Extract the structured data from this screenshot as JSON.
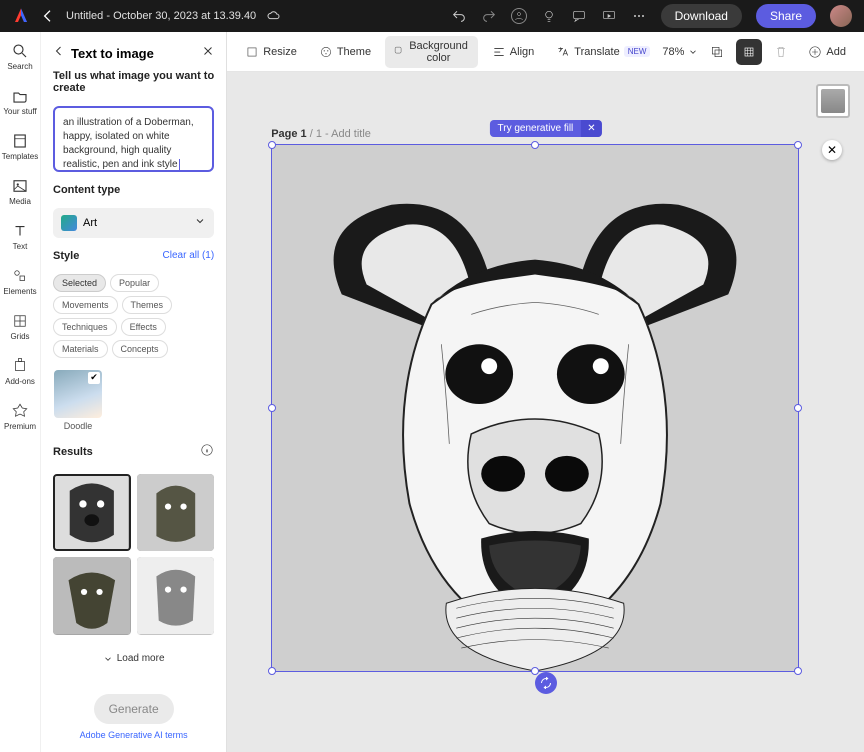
{
  "topbar": {
    "title": "Untitled - October 30, 2023 at 13.39.40",
    "download": "Download",
    "share": "Share"
  },
  "leftbar": {
    "items": [
      {
        "label": "Search"
      },
      {
        "label": "Your stuff"
      },
      {
        "label": "Templates"
      },
      {
        "label": "Media"
      },
      {
        "label": "Text"
      },
      {
        "label": "Elements"
      },
      {
        "label": "Grids"
      },
      {
        "label": "Add-ons"
      },
      {
        "label": "Premium"
      }
    ]
  },
  "panel": {
    "title": "Text to image",
    "prompt_label": "Tell us what image you want to create",
    "prompt_value": "an illustration of a Doberman, happy, isolated on white background, high quality realistic, pen and ink style",
    "content_type_label": "Content type",
    "content_type_value": "Art",
    "style_label": "Style",
    "clear_all": "Clear all (1)",
    "chips": [
      "Selected",
      "Popular",
      "Movements",
      "Themes",
      "Techniques",
      "Effects",
      "Materials",
      "Concepts"
    ],
    "style_thumb_name": "Doodle",
    "results_label": "Results",
    "load_more": "Load more",
    "generate": "Generate",
    "ai_terms": "Adobe Generative AI terms"
  },
  "toolbar": {
    "resize": "Resize",
    "theme": "Theme",
    "bgcolor": "Background color",
    "align": "Align",
    "translate": "Translate",
    "new_badge": "NEW",
    "zoom": "78%",
    "add": "Add"
  },
  "canvas": {
    "page_label_a": "Page 1",
    "page_label_b": "/ 1",
    "add_title": " - Add title",
    "try_fill": "Try generative fill"
  }
}
